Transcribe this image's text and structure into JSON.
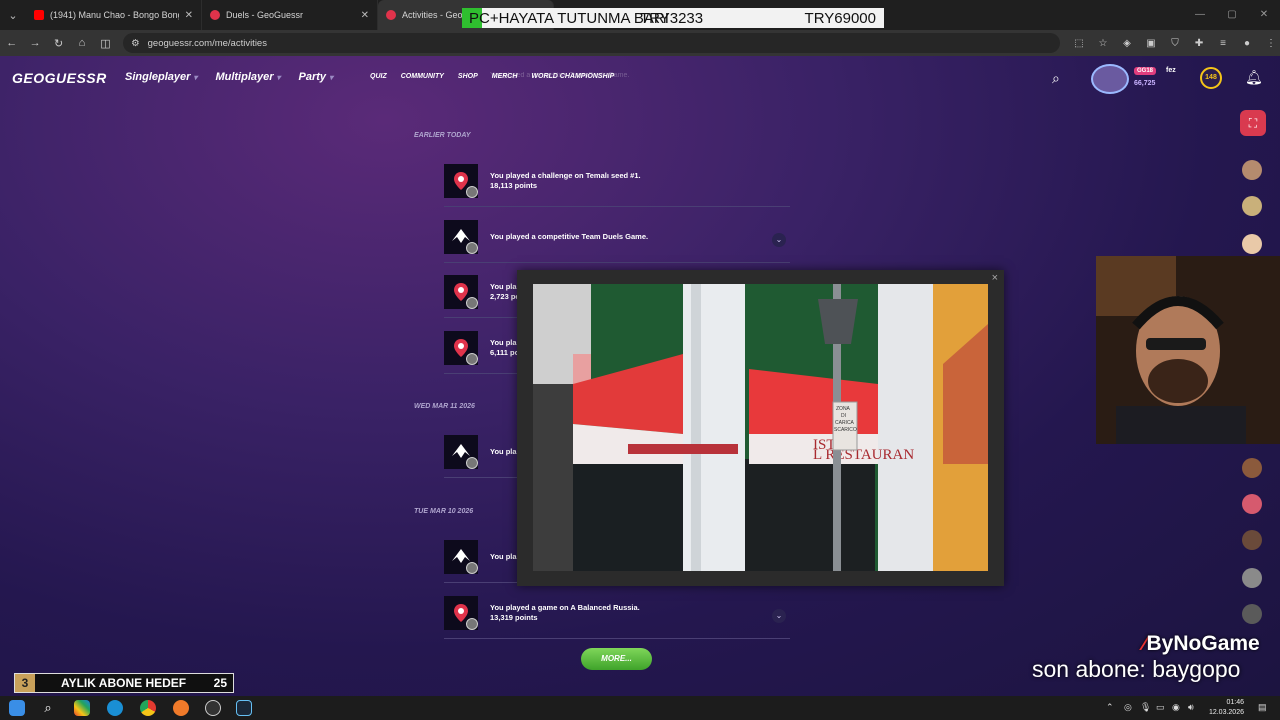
{
  "browser": {
    "tabs": [
      {
        "title": "(1941) Manu Chao - Bongo Bong",
        "favicon_color": "#ff0000",
        "active": false
      },
      {
        "title": "Duels - GeoGuessr",
        "favicon_color": "#e0334b",
        "active": false
      },
      {
        "title": "Activities - GeoGuessr",
        "favicon_color": "#e0334b",
        "active": true
      }
    ],
    "url": "geoguessr.com/me/activities"
  },
  "overlay_banner": {
    "goal_text": "PC+HAYATA TUTUNMA BARI",
    "current": "TRY3233",
    "target": "TRY69000",
    "progress_percent": 4.7
  },
  "header": {
    "logo": "GEOGUESSR",
    "main_nav": [
      "Singleplayer",
      "Multiplayer",
      "Party"
    ],
    "sub_nav": [
      "QUIZ",
      "COMMUNITY",
      "SHOP",
      "MERCH",
      "WORLD CHAMPIONSHIP"
    ],
    "user": {
      "badge": "GG18",
      "name": "fez",
      "xp": "66,725",
      "level": "148"
    }
  },
  "activities": {
    "faded_text": "You played a competitive Team Duels Game.",
    "sections": [
      {
        "label": "EARLIER TODAY"
      },
      {
        "label": "WED MAR 11 2026"
      },
      {
        "label": "TUE MAR 10 2026"
      }
    ],
    "items": [
      {
        "type": "pin",
        "line1": "You played a challenge on Temalı seed #1.",
        "line2": "18,113 points",
        "expand": false
      },
      {
        "type": "duel",
        "line1": "You played a competitive Team Duels Game.",
        "line2": "",
        "expand": true
      },
      {
        "type": "pin",
        "line1": "You pla",
        "line2": "2,723 po",
        "expand": false
      },
      {
        "type": "pin",
        "line1": "You pla",
        "line2": "6,111 po",
        "expand": false
      },
      {
        "type": "duel",
        "line1": "You pla",
        "line2": "",
        "expand": false
      },
      {
        "type": "duel",
        "line1": "You pla",
        "line2": "",
        "expand": false
      },
      {
        "type": "pin",
        "line1": "You played a game on A Balanced Russia.",
        "line2": "13,319 points",
        "expand": true
      }
    ],
    "more_label": "MORE..."
  },
  "popup": {
    "close": "×",
    "signs": [
      "ZONA",
      "DI",
      "CARICA",
      "SCARICO",
      "ISTI",
      "L RESTAURAN"
    ]
  },
  "right_rail": {
    "notification_count": "1"
  },
  "stream": {
    "sub_goal": {
      "current": "3",
      "label": "AYLIK ABONE HEDEF",
      "target": "25"
    },
    "brand": "ByNoGame",
    "last_sub": "son abone: baygopo"
  },
  "taskbar": {
    "time": "01:46",
    "date": "12.03.2026"
  }
}
